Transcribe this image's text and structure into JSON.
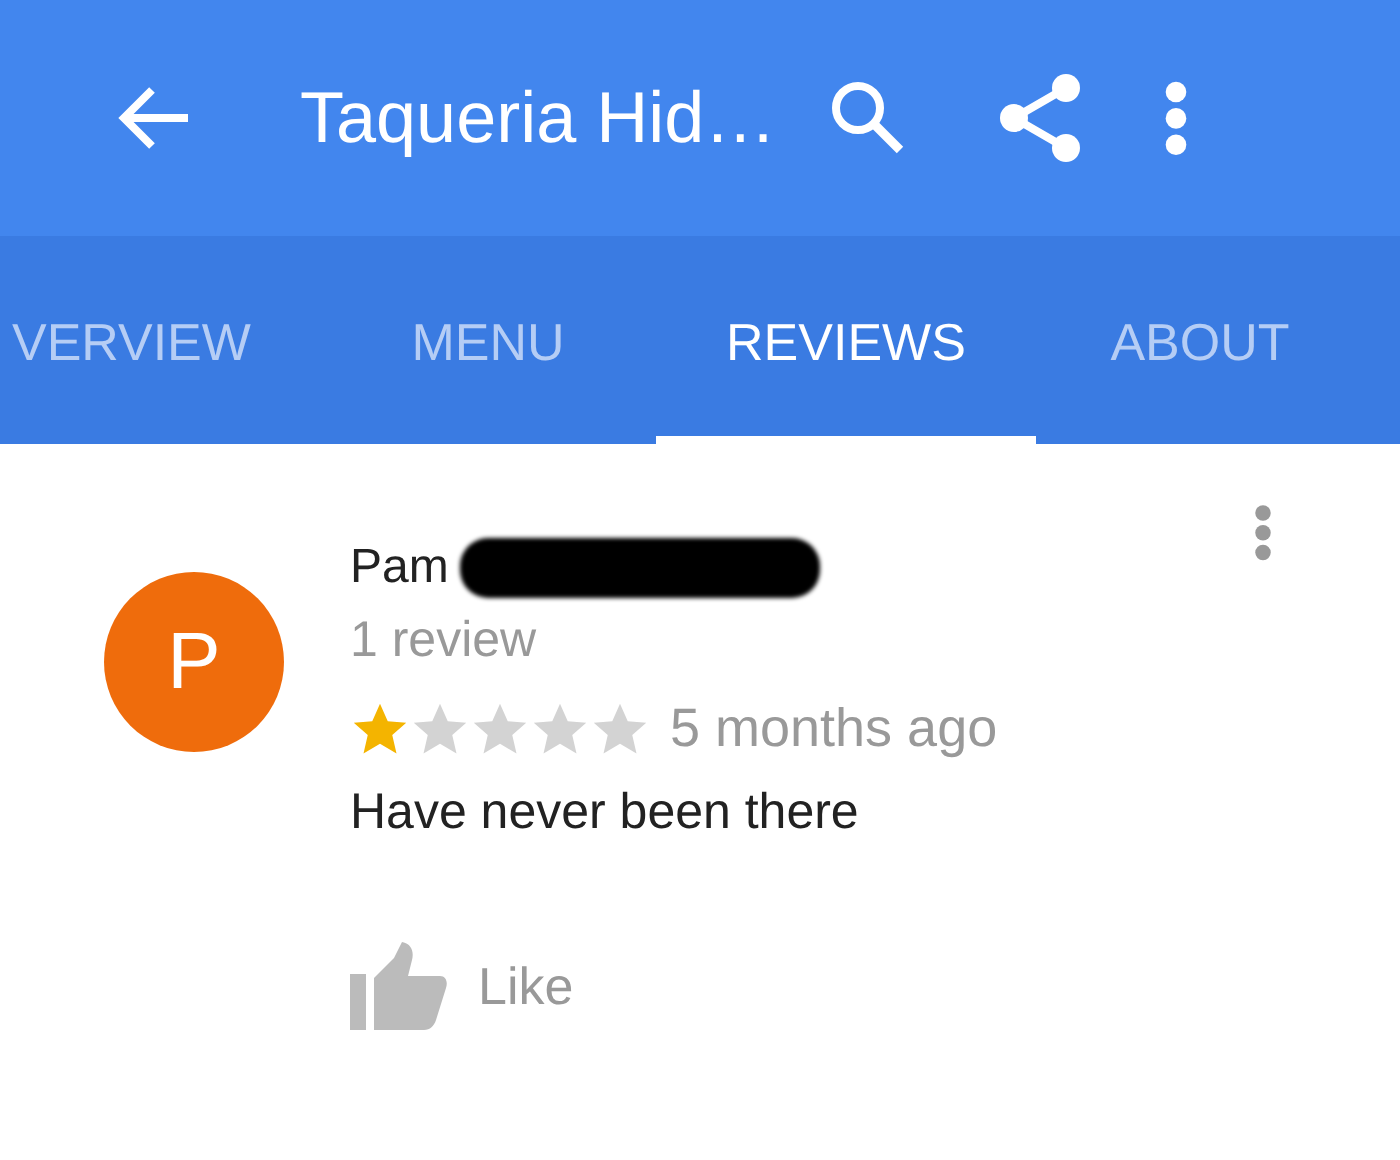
{
  "app_bar": {
    "title": "Taqueria Hid…"
  },
  "tabs": [
    {
      "label": "VERVIEW",
      "selected": false
    },
    {
      "label": "MENU",
      "selected": false
    },
    {
      "label": "REVIEWS",
      "selected": true
    },
    {
      "label": "ABOUT",
      "selected": false
    }
  ],
  "review": {
    "avatar_letter": "P",
    "author": "Pam",
    "author_redacted": true,
    "review_count": "1 review",
    "stars": 1,
    "time": "5 months ago",
    "text": "Have never been there",
    "like_label": "Like"
  }
}
